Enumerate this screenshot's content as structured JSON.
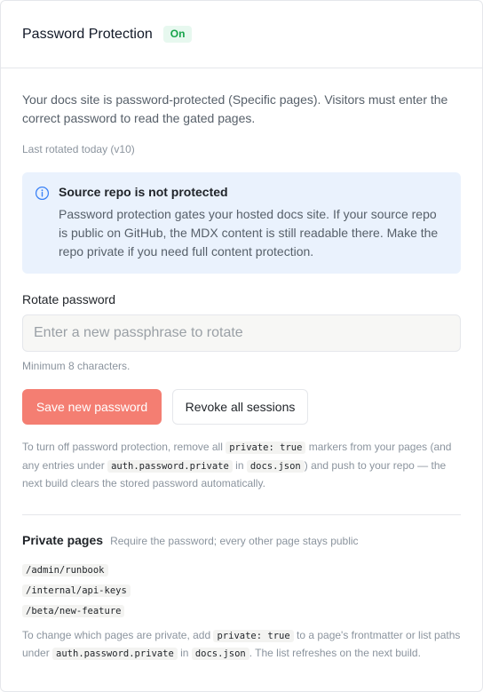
{
  "header": {
    "title": "Password Protection",
    "status": "On"
  },
  "description": "Your docs site is password-protected (Specific pages). Visitors must enter the correct password to read the gated pages.",
  "last_rotated": "Last rotated today (v10)",
  "alert": {
    "icon": "info-icon",
    "title": "Source repo is not protected",
    "text": "Password protection gates your hosted docs site. If your source repo is public on GitHub, the MDX content is still readable there. Make the repo private if you need full content protection."
  },
  "rotate": {
    "label": "Rotate password",
    "placeholder": "Enter a new passphrase to rotate",
    "value": "",
    "hint": "Minimum 8 characters."
  },
  "buttons": {
    "save": "Save new password",
    "revoke": "Revoke all sessions"
  },
  "turn_off_note": {
    "t1": "To turn off password protection, remove all ",
    "c1": "private: true",
    "t2": " markers from your pages (and any entries under ",
    "c2": "auth.password.private",
    "t3": " in ",
    "c3": "docs.json",
    "t4": ") and push to your repo — the next build clears the stored password automatically."
  },
  "private_pages": {
    "title": "Private pages",
    "subtitle": "Require the password; every other page stays public",
    "paths": [
      "/admin/runbook",
      "/internal/api-keys",
      "/beta/new-feature"
    ]
  },
  "change_note": {
    "t1": "To change which pages are private, add ",
    "c1": "private: true",
    "t2": " to a page's frontmatter or list paths under ",
    "c2": "auth.password.private",
    "t3": " in ",
    "c3": "docs.json",
    "t4": ". The list refreshes on the next build."
  },
  "colors": {
    "accent": "#f47e72",
    "badge_bg": "#e7f8ef",
    "badge_text": "#16a34a",
    "alert_bg": "#eaf2fd"
  }
}
